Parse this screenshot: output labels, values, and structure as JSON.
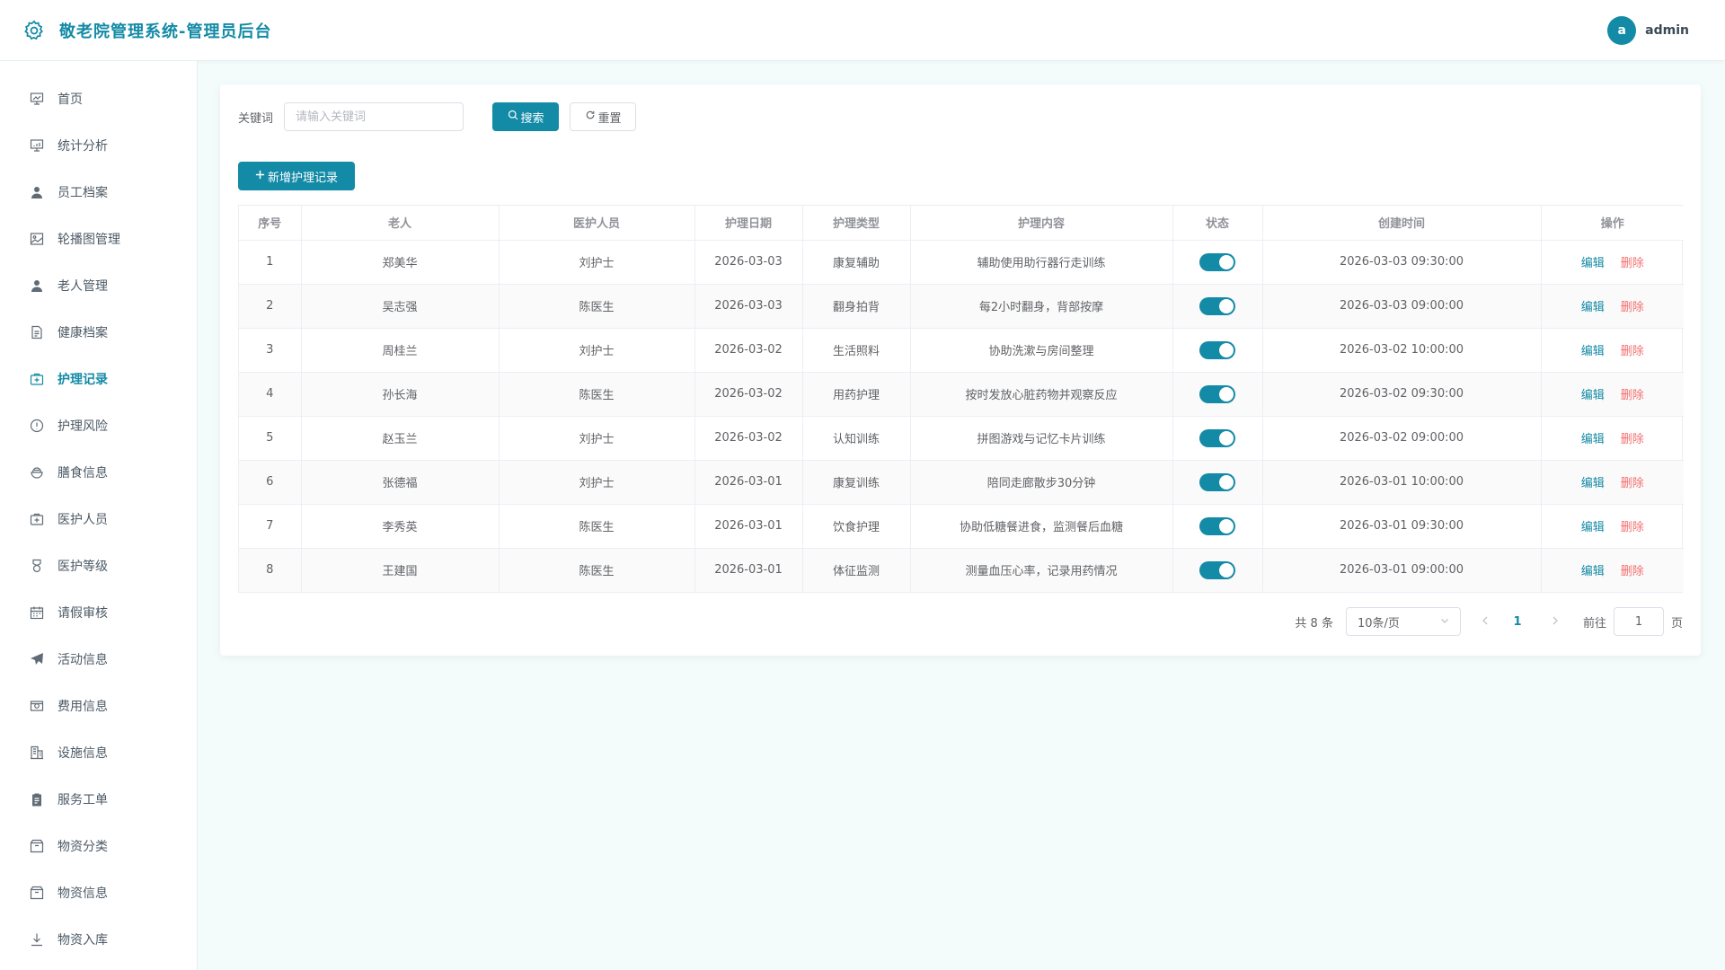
{
  "header": {
    "title": "敬老院管理系统-管理员后台",
    "avatar_letter": "a",
    "username": "admin"
  },
  "sidebar": {
    "items": [
      {
        "label": "首页",
        "icon": "presentation-icon"
      },
      {
        "label": "统计分析",
        "icon": "chart-board-icon"
      },
      {
        "label": "员工档案",
        "icon": "user-icon"
      },
      {
        "label": "轮播图管理",
        "icon": "picture-icon"
      },
      {
        "label": "老人管理",
        "icon": "user-icon"
      },
      {
        "label": "健康档案",
        "icon": "document-icon"
      },
      {
        "label": "护理记录",
        "icon": "first-aid-kit-icon"
      },
      {
        "label": "护理风险",
        "icon": "warning-icon"
      },
      {
        "label": "膳食信息",
        "icon": "food-icon"
      },
      {
        "label": "医护人员",
        "icon": "first-aid-kit-icon"
      },
      {
        "label": "医护等级",
        "icon": "medal-icon"
      },
      {
        "label": "请假审核",
        "icon": "calendar-icon"
      },
      {
        "label": "活动信息",
        "icon": "send-icon"
      },
      {
        "label": "费用信息",
        "icon": "money-icon"
      },
      {
        "label": "设施信息",
        "icon": "office-building-icon"
      },
      {
        "label": "服务工单",
        "icon": "clipboard-icon"
      },
      {
        "label": "物资分类",
        "icon": "box-icon"
      },
      {
        "label": "物资信息",
        "icon": "box-icon"
      },
      {
        "label": "物资入库",
        "icon": "download-icon"
      }
    ],
    "active_index": 6
  },
  "search": {
    "label": "关键词",
    "placeholder": "请输入关键词",
    "search_btn": "搜索",
    "reset_btn": "重置"
  },
  "add_btn": "新增护理记录",
  "table": {
    "columns": [
      "序号",
      "老人",
      "医护人员",
      "护理日期",
      "护理类型",
      "护理内容",
      "状态",
      "创建时间",
      "操作"
    ],
    "rows": [
      {
        "no": "1",
        "elder": "郑美华",
        "staff": "刘护士",
        "date": "2026-03-03",
        "type": "康复辅助",
        "content": "辅助使用助行器行走训练",
        "status": true,
        "created": "2026-03-03 09:30:00"
      },
      {
        "no": "2",
        "elder": "吴志强",
        "staff": "陈医生",
        "date": "2026-03-03",
        "type": "翻身拍背",
        "content": "每2小时翻身，背部按摩",
        "status": true,
        "created": "2026-03-03 09:00:00"
      },
      {
        "no": "3",
        "elder": "周桂兰",
        "staff": "刘护士",
        "date": "2026-03-02",
        "type": "生活照料",
        "content": "协助洗漱与房间整理",
        "status": true,
        "created": "2026-03-02 10:00:00"
      },
      {
        "no": "4",
        "elder": "孙长海",
        "staff": "陈医生",
        "date": "2026-03-02",
        "type": "用药护理",
        "content": "按时发放心脏药物并观察反应",
        "status": true,
        "created": "2026-03-02 09:30:00"
      },
      {
        "no": "5",
        "elder": "赵玉兰",
        "staff": "刘护士",
        "date": "2026-03-02",
        "type": "认知训练",
        "content": "拼图游戏与记忆卡片训练",
        "status": true,
        "created": "2026-03-02 09:00:00"
      },
      {
        "no": "6",
        "elder": "张德福",
        "staff": "刘护士",
        "date": "2026-03-01",
        "type": "康复训练",
        "content": "陪同走廊散步30分钟",
        "status": true,
        "created": "2026-03-01 10:00:00"
      },
      {
        "no": "7",
        "elder": "李秀英",
        "staff": "陈医生",
        "date": "2026-03-01",
        "type": "饮食护理",
        "content": "协助低糖餐进食，监测餐后血糖",
        "status": true,
        "created": "2026-03-01 09:30:00"
      },
      {
        "no": "8",
        "elder": "王建国",
        "staff": "陈医生",
        "date": "2026-03-01",
        "type": "体征监测",
        "content": "测量血压心率，记录用药情况",
        "status": true,
        "created": "2026-03-01 09:00:00"
      }
    ],
    "edit_label": "编辑",
    "delete_label": "删除"
  },
  "pagination": {
    "total_text": "共 8 条",
    "page_size": "10条/页",
    "current_page": "1",
    "goto_label": "前往",
    "goto_value": "1",
    "page_suffix": "页"
  },
  "colors": {
    "primary": "#138aa6",
    "danger": "#f56c6c",
    "background": "#f3fbfb"
  }
}
